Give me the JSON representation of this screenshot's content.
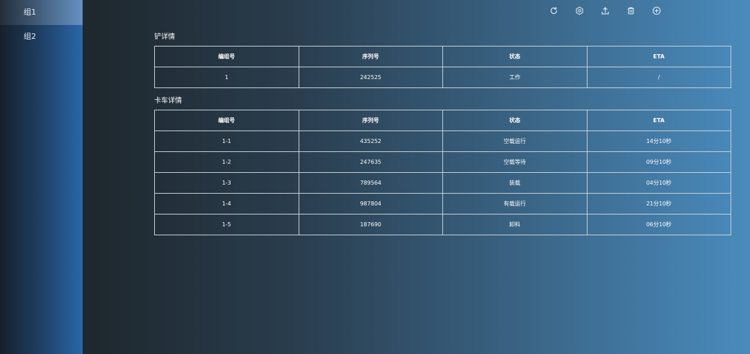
{
  "sidebar": {
    "items": [
      {
        "label": "组1",
        "active": true
      },
      {
        "label": "组2",
        "active": false
      }
    ]
  },
  "toolbar": {
    "icons": [
      "refresh-icon",
      "settings-icon",
      "upload-icon",
      "delete-icon",
      "add-icon"
    ],
    "icon_color": "#e6edf3"
  },
  "shovel": {
    "title": "铲详情",
    "headers": [
      "编组号",
      "序列号",
      "状态",
      "ETA"
    ],
    "rows": [
      [
        "1",
        "242525",
        "工作",
        "/"
      ]
    ]
  },
  "truck": {
    "title": "卡车详情",
    "headers": [
      "编组号",
      "序列号",
      "状态",
      "ETA"
    ],
    "rows": [
      [
        "1-1",
        "435252",
        "空载运行",
        "14分10秒"
      ],
      [
        "1-2",
        "247635",
        "空载等待",
        "09分10秒"
      ],
      [
        "1-3",
        "789564",
        "装载",
        "04分10秒"
      ],
      [
        "1-4",
        "987804",
        "有载运行",
        "21分10秒"
      ],
      [
        "1-5",
        "187690",
        "卸料",
        "06分10秒"
      ]
    ]
  }
}
